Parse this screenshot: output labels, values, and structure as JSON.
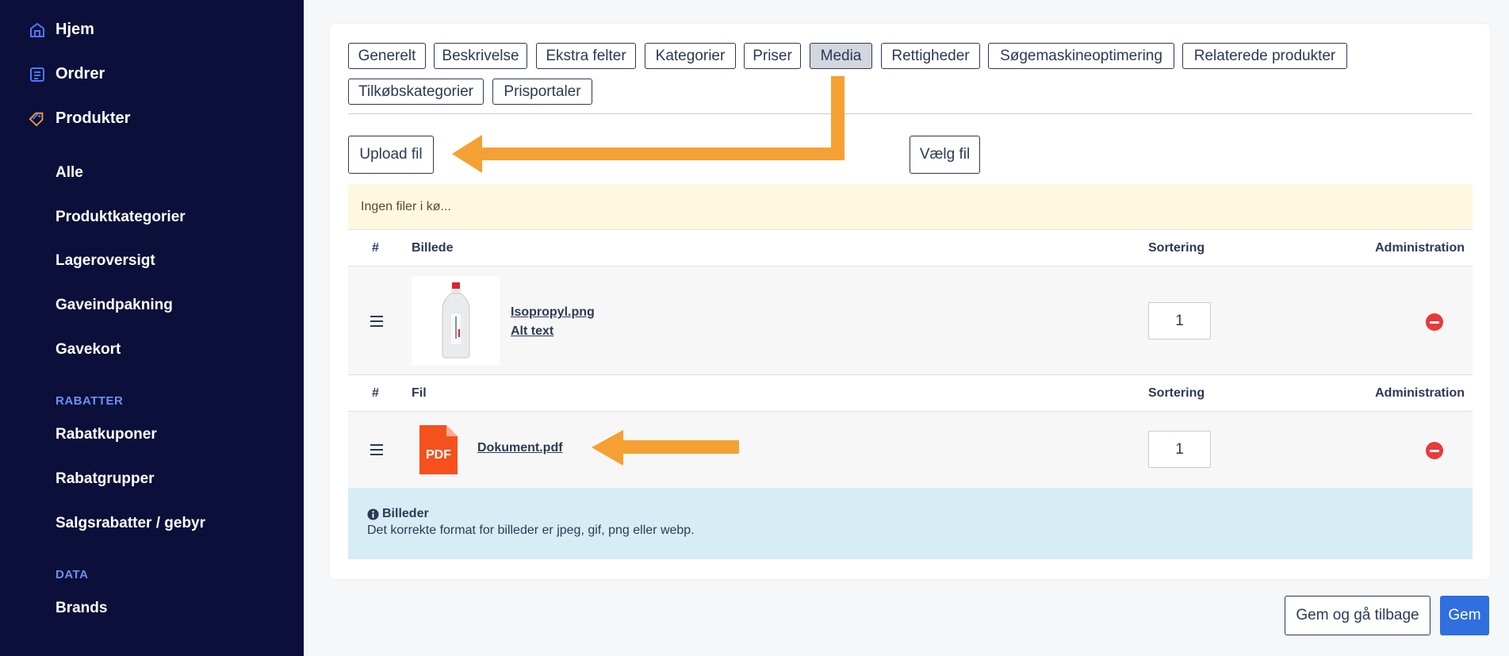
{
  "sidebar": {
    "main": [
      {
        "label": "Hjem",
        "icon": "home-icon"
      },
      {
        "label": "Ordrer",
        "icon": "orders-icon"
      },
      {
        "label": "Produkter",
        "icon": "tag-icon"
      }
    ],
    "products": [
      "Alle",
      "Produktkategorier",
      "Lageroversigt",
      "Gaveindpakning",
      "Gavekort"
    ],
    "discounts_heading": "RABATTER",
    "discounts": [
      "Rabatkuponer",
      "Rabatgrupper",
      "Salgsrabatter / gebyr"
    ],
    "data_heading": "DATA",
    "data": [
      "Brands"
    ]
  },
  "tabs": [
    "Generelt",
    "Beskrivelse",
    "Ekstra felter",
    "Kategorier",
    "Priser",
    "Media",
    "Rettigheder",
    "Søgemaskineoptimering",
    "Relaterede produkter",
    "Tilkøbskategorier",
    "Prisportaler"
  ],
  "active_tab": "Media",
  "upload_button": "Upload fil",
  "choose_button": "Vælg fil",
  "queue_text": "Ingen filer i kø...",
  "images_table": {
    "headers": [
      "#",
      "Billede",
      "Sortering",
      "Administration"
    ],
    "rows": [
      {
        "file": "Isopropyl.png",
        "alt": "Alt text",
        "sort": "1"
      }
    ]
  },
  "files_table": {
    "headers": [
      "#",
      "Fil",
      "Sortering",
      "Administration"
    ],
    "rows": [
      {
        "icon_text": "PDF",
        "file": "Dokument.pdf",
        "sort": "1"
      }
    ]
  },
  "info": {
    "title": "Billeder",
    "text": "Det korrekte format for billeder er jpeg, gif, png eller webp."
  },
  "actions": {
    "save_back": "Gem og gå tilbage",
    "save": "Gem"
  },
  "colors": {
    "sidebar_bg": "#0b0f3a",
    "accent": "#2f6fe0",
    "arrow": "#f5a033",
    "danger": "#e83a3a",
    "pdf": "#f4511e"
  }
}
